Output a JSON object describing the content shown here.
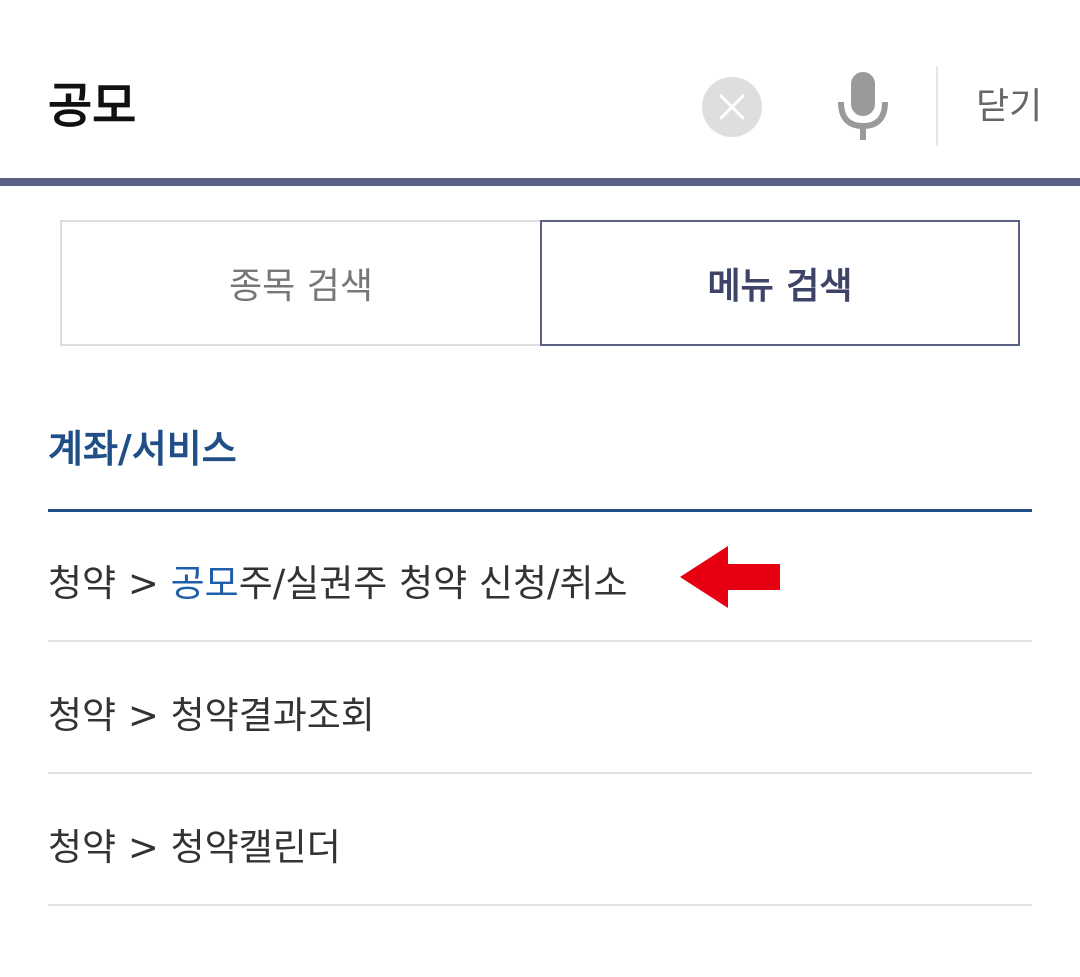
{
  "search": {
    "query": "공모",
    "close_label": "닫기",
    "clear_icon": "clear-circle-x-icon",
    "mic_icon": "microphone-icon"
  },
  "tabs": [
    {
      "label": "종목 검색",
      "active": false
    },
    {
      "label": "메뉴 검색",
      "active": true
    }
  ],
  "section": {
    "title": "계좌/서비스"
  },
  "results": [
    {
      "prefix": "청약 > ",
      "highlight": "공모",
      "rest": "주/실권주 청약 신청/취소"
    },
    {
      "prefix": "청약 > ",
      "highlight": "",
      "rest": "청약결과조회"
    },
    {
      "prefix": "청약 > ",
      "highlight": "",
      "rest": "청약캘린더"
    }
  ],
  "annotation": {
    "icon": "left-arrow-icon",
    "color": "#e60012"
  },
  "colors": {
    "accent": "#5b6184",
    "section": "#1f4f86",
    "highlight": "#1f5ea8"
  }
}
